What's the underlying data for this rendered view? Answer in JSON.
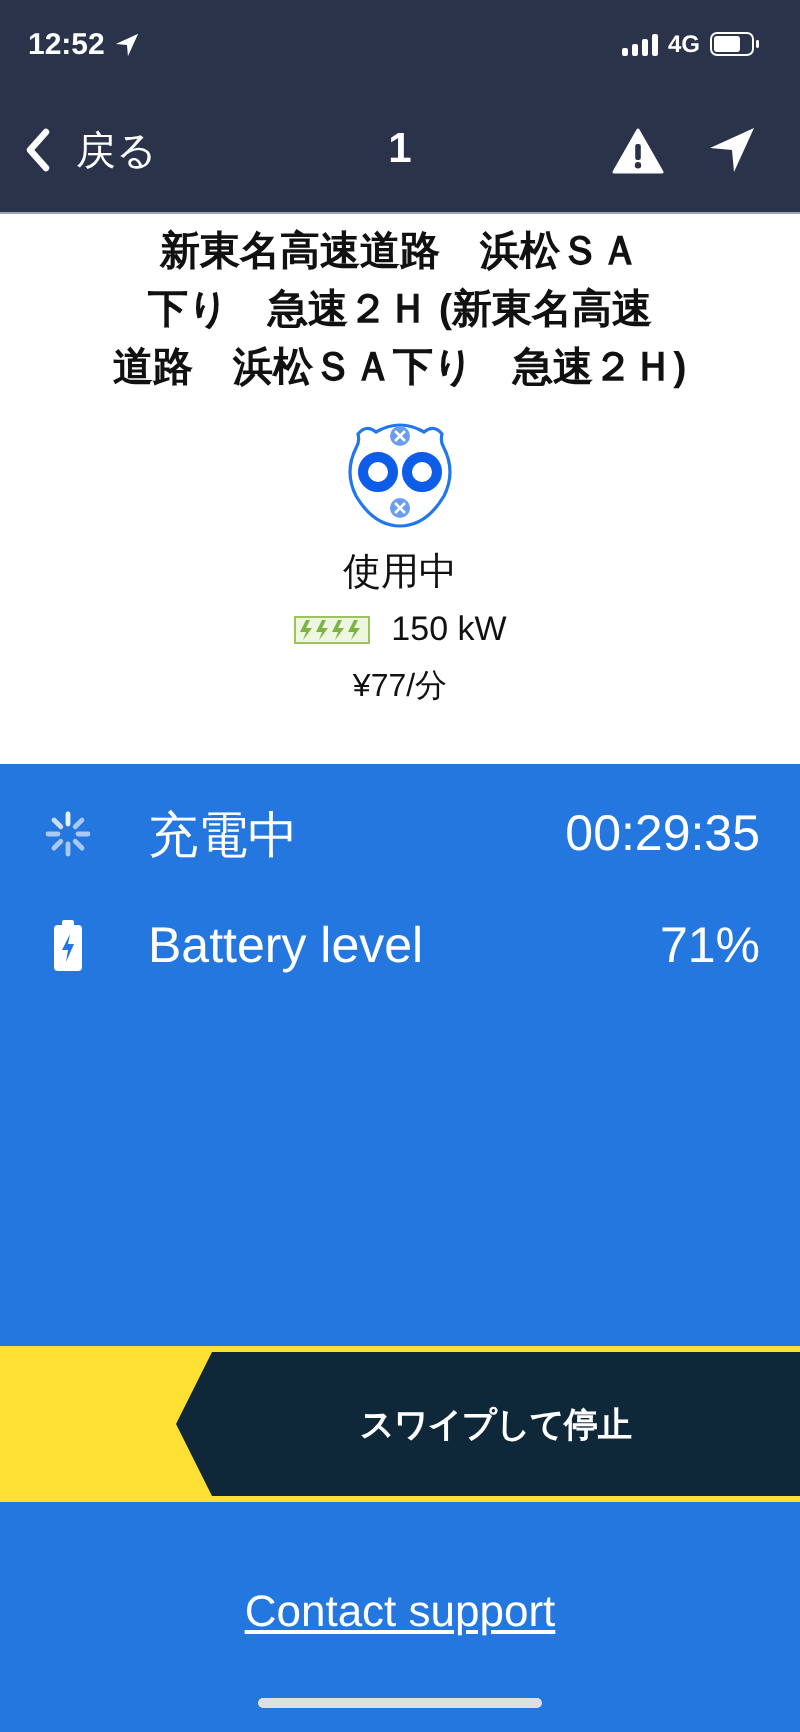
{
  "status_bar": {
    "time": "12:52",
    "network": "4G"
  },
  "nav": {
    "back_label": "戻る",
    "title": "1"
  },
  "station": {
    "name_lines": [
      "新東名高速道路　浜松ＳＡ",
      "下り　急速２Ｈ (新東名高速",
      "道路　浜松ＳＡ下り　急速２Ｈ)"
    ],
    "status": "使用中",
    "power": "150 kW",
    "price": "¥77/分"
  },
  "session": [
    {
      "kind": "charging",
      "label": "充電中",
      "value": "00:29:35"
    },
    {
      "kind": "battery",
      "label": "Battery level",
      "value": "71%"
    }
  ],
  "swipe_control": {
    "label": "スワイプして停止"
  },
  "contact_link": "Contact support"
}
